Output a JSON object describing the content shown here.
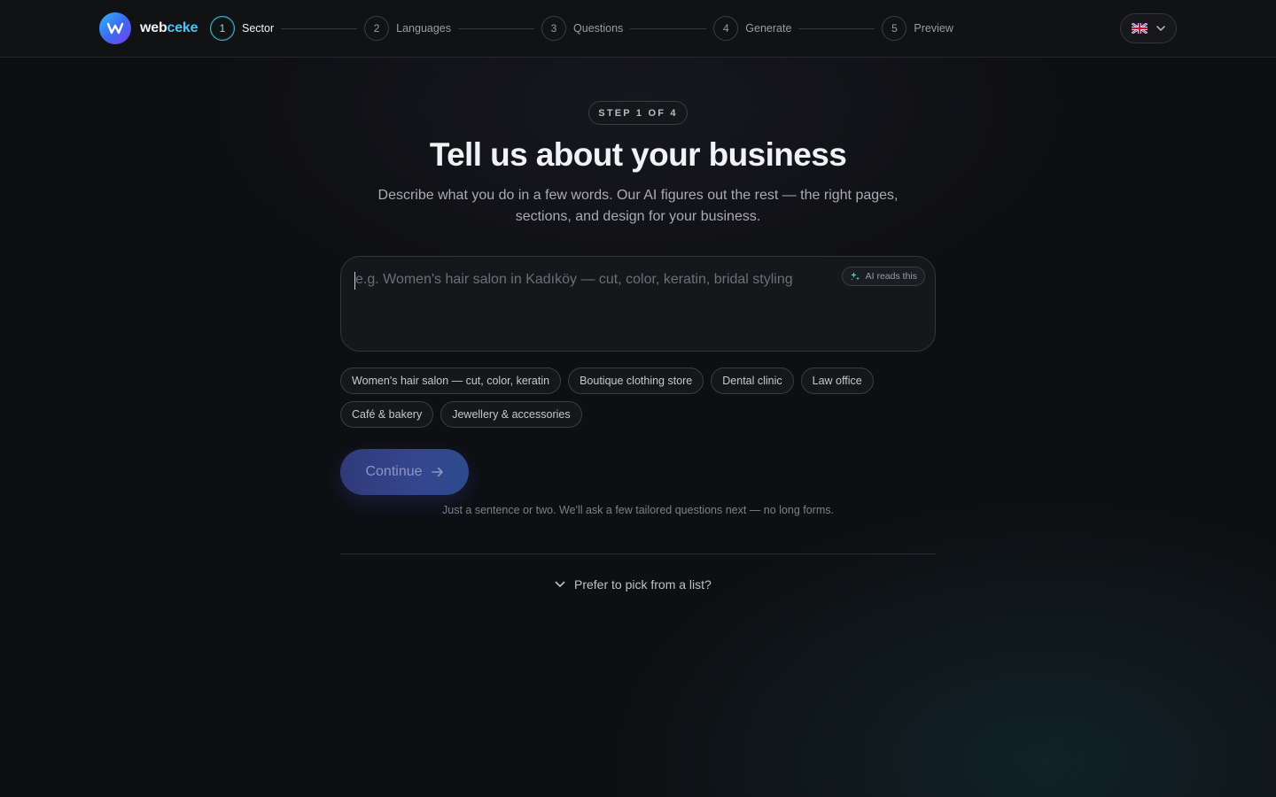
{
  "app": {
    "brand_prefix": "web",
    "brand_suffix": "ceke"
  },
  "stepper": {
    "steps": [
      {
        "num": "1",
        "label": "Sector",
        "active": true
      },
      {
        "num": "2",
        "label": "Languages"
      },
      {
        "num": "3",
        "label": "Questions"
      },
      {
        "num": "4",
        "label": "Generate"
      },
      {
        "num": "5",
        "label": "Preview"
      }
    ]
  },
  "language": {
    "current": "uk-flag-icon"
  },
  "main": {
    "badge": "STEP 1 OF 4",
    "title": "Tell us about your business",
    "subtitle": "Describe what you do in a few words. Our AI figures out the rest — the right pages, sections, and design for your business.",
    "input": {
      "value": "",
      "placeholder": "e.g. Women's hair salon in Kadıköy — cut, color, keratin, bridal styling",
      "ai_chip": "AI reads this"
    },
    "suggestions": [
      "Women's hair salon — cut, color, keratin",
      "Boutique clothing store",
      "Dental clinic",
      "Law office",
      "Café & bakery",
      "Jewellery & accessories"
    ],
    "continue_label": "Continue",
    "hint": "Just a sentence or two. We'll ask a few tailored questions next — no long forms.",
    "pick_from_list": "Prefer to pick from a list?"
  },
  "colors": {
    "accent": "#49c6ff",
    "active_step": "#3fb6d6",
    "button": "#35468e"
  }
}
